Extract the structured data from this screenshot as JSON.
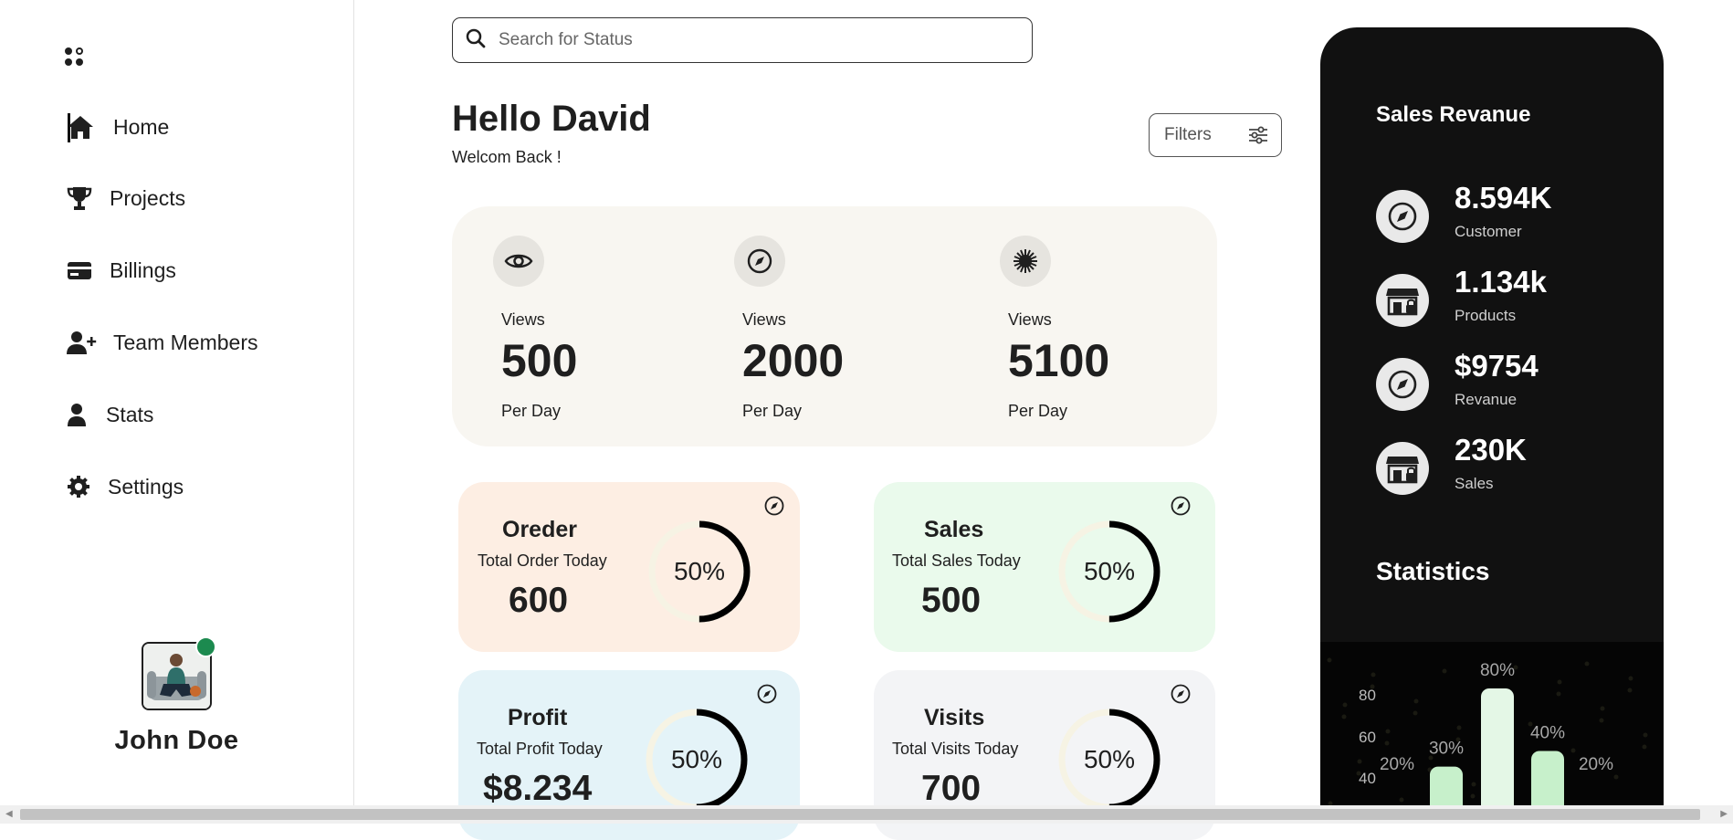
{
  "sidebar": {
    "items": [
      {
        "label": "Home",
        "icon": "home-icon",
        "active": true
      },
      {
        "label": "Projects",
        "icon": "trophy-icon"
      },
      {
        "label": "Billings",
        "icon": "credit-card-icon"
      },
      {
        "label": "Team Members",
        "icon": "user-plus-icon"
      },
      {
        "label": "Stats",
        "icon": "user-icon"
      },
      {
        "label": "Settings",
        "icon": "gear-icon"
      }
    ],
    "profile": {
      "name": "John Doe",
      "status_color": "#1c8a4f"
    }
  },
  "search": {
    "placeholder": "Search for Status"
  },
  "greeting": {
    "title": "Hello David",
    "subtitle": "Welcom Back !"
  },
  "filters": {
    "label": "Filters"
  },
  "views": [
    {
      "icon": "eye-icon",
      "label": "Views",
      "value": "500",
      "sub": "Per Day"
    },
    {
      "icon": "compass-icon",
      "label": "Views",
      "value": "2000",
      "sub": "Per Day"
    },
    {
      "icon": "sun-icon",
      "label": "Views",
      "value": "5100",
      "sub": "Per Day"
    }
  ],
  "cards": [
    {
      "title": "Oreder",
      "desc": "Total Order Today",
      "value": "600",
      "percent": "50%",
      "progress": 0.5,
      "bg": "#fdeee3"
    },
    {
      "title": "Sales",
      "desc": "Total Sales Today",
      "value": "500",
      "percent": "50%",
      "progress": 0.5,
      "bg": "#eafaec"
    },
    {
      "title": "Profit",
      "desc": "Total Profit Today",
      "value": "$8.234",
      "percent": "50%",
      "progress": 0.5,
      "bg": "#e4f3f8"
    },
    {
      "title": "Visits",
      "desc": "Total Visits Today",
      "value": "700",
      "percent": "50%",
      "progress": 0.5,
      "bg": "#f3f4f6"
    }
  ],
  "revenue": {
    "title": "Sales Revanue",
    "items": [
      {
        "icon": "compass-icon",
        "value": "8.594K",
        "label": "Customer"
      },
      {
        "icon": "store-icon",
        "value": "1.134k",
        "label": "Products"
      },
      {
        "icon": "compass-icon",
        "value": "$9754",
        "label": "Revanue"
      },
      {
        "icon": "store-icon",
        "value": "230K",
        "label": "Sales"
      }
    ]
  },
  "statistics": {
    "title": "Statistics"
  },
  "chart_data": {
    "type": "bar",
    "ticks": [
      "80",
      "60",
      "40"
    ],
    "ylim": [
      0,
      100
    ],
    "grid": false,
    "series": [
      {
        "label": "20%",
        "value": 20
      },
      {
        "label": "30%",
        "value": 30
      },
      {
        "label": "80%",
        "value": 80
      },
      {
        "label": "40%",
        "value": 40
      },
      {
        "label": "20%",
        "value": 20
      }
    ]
  },
  "colors": {
    "panel_bg": "#111111",
    "bar_fill": "#c7f0cb",
    "bar_fill_tall": "#e4f7e6",
    "ring": "#000000",
    "ring_track": "#f6f3e4"
  }
}
